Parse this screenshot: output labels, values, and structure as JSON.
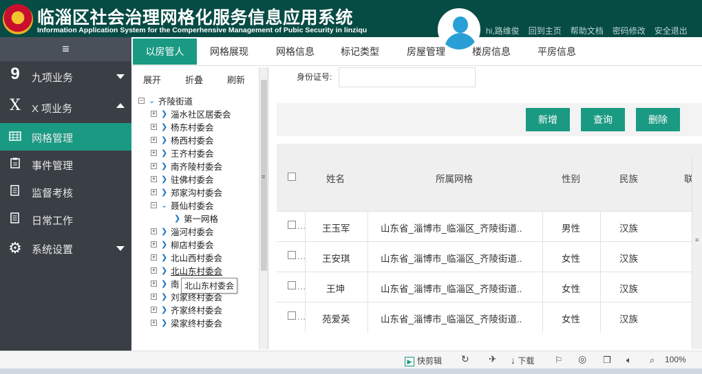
{
  "header": {
    "title_cn": "临淄区社会治理网格化服务信息应用系统",
    "title_en": "Information Application System for the Comperhensive Management of Pubic Security in linziqu",
    "greeting": "hi,路维俊",
    "links": [
      "回到主页",
      "帮助文档",
      "密码修改",
      "安全退出"
    ]
  },
  "sidebar": {
    "menu_icon": "≡",
    "items": [
      {
        "label": "九项业务",
        "icon": "9",
        "arrow": "down"
      },
      {
        "label": "X 项业务",
        "icon": "X",
        "arrow": "up"
      },
      {
        "label": "网格管理",
        "icon": "grid-icon",
        "active": true
      },
      {
        "label": "事件管理",
        "icon": "clipboard-icon"
      },
      {
        "label": "监督考核",
        "icon": "document-icon"
      },
      {
        "label": "日常工作",
        "icon": "document-icon"
      },
      {
        "label": "系统设置",
        "icon": "gear-icon",
        "arrow": "down"
      }
    ]
  },
  "tabs": [
    "以房管人",
    "网格展现",
    "网格信息",
    "标记类型",
    "房屋管理",
    "楼房信息",
    "平房信息"
  ],
  "tree": {
    "tools": [
      "展开",
      "折叠",
      "刷新"
    ],
    "root": "齐陵街道",
    "nodes": [
      "淄水社区居委会",
      "杨东村委会",
      "杨西村委会",
      "王齐村委会",
      "南齐陵村委会",
      "驻佛村委会",
      "郑家沟村委会",
      "聂仙村委会",
      "第一网格",
      "淄河村委会",
      "柳店村委会",
      "北山西村委会",
      "北山东村委会",
      "南",
      "刘家终村委会",
      "齐家终村委会",
      "梁家终村委会"
    ],
    "tooltip": "北山东村委会"
  },
  "form": {
    "id_label": "身份证号:",
    "id_value": ""
  },
  "buttons": {
    "add": "新增",
    "query": "查询",
    "delete": "删除"
  },
  "table": {
    "columns": [
      "姓名",
      "所属网格",
      "性别",
      "民族",
      "联"
    ],
    "rows": [
      {
        "name": "王玉军",
        "grid": "山东省_淄博市_临淄区_齐陵街道..",
        "gender": "男性",
        "ethnicity": "汉族"
      },
      {
        "name": "王安琪",
        "grid": "山东省_淄博市_临淄区_齐陵街道..",
        "gender": "女性",
        "ethnicity": "汉族"
      },
      {
        "name": "王坤",
        "grid": "山东省_淄博市_临淄区_齐陵街道..",
        "gender": "女性",
        "ethnicity": "汉族"
      },
      {
        "name": "苑爱英",
        "grid": "山东省_淄博市_临淄区_齐陵街道..",
        "gender": "女性",
        "ethnicity": "汉族"
      }
    ]
  },
  "status_bar": {
    "kuaijianji": "快剪辑",
    "download": "下载",
    "zoom": "100%"
  },
  "colors": {
    "header_bg": "#064b44",
    "accent": "#1a9a83",
    "sidebar_bg": "#3a3f46"
  }
}
